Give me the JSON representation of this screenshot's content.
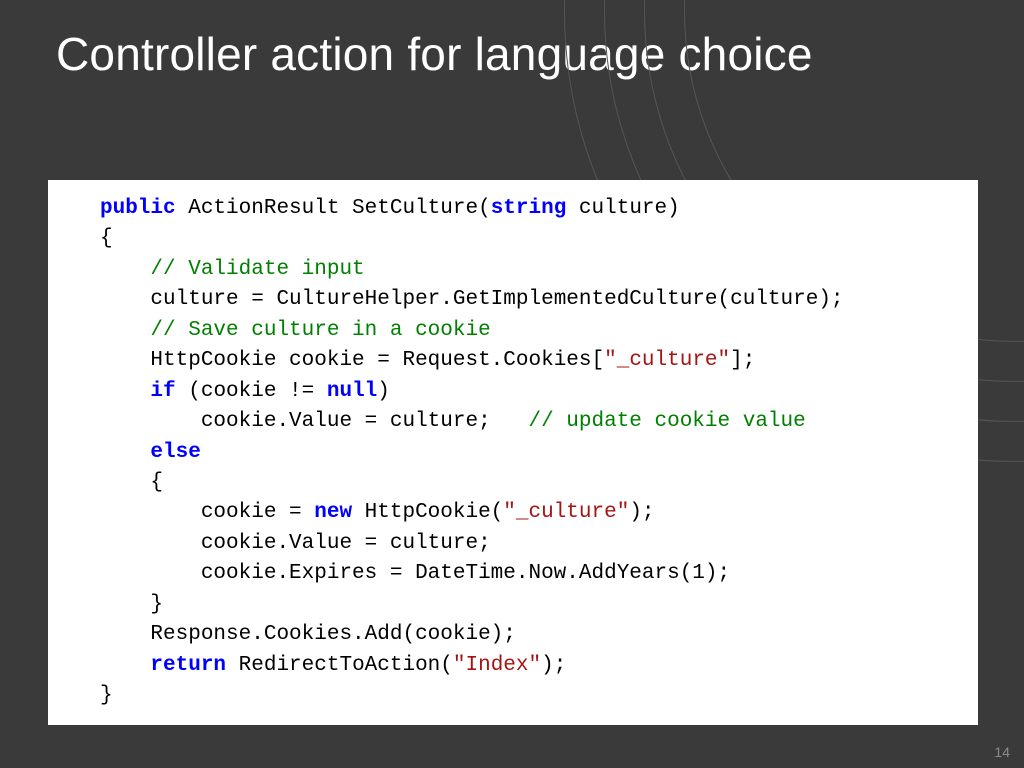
{
  "title": "Controller action for language choice",
  "page_number": "14",
  "code": {
    "l1": {
      "kw1": "public",
      "t1": " ActionResult SetCulture(",
      "kw2": "string",
      "t2": " culture)"
    },
    "l2": "{",
    "l3": {
      "indent": "    ",
      "cm": "// Validate input"
    },
    "l4": {
      "indent": "    ",
      "t": "culture = CultureHelper.GetImplementedCulture(culture);"
    },
    "l5": {
      "indent": "    ",
      "cm": "// Save culture in a cookie"
    },
    "l6": {
      "indent": "    ",
      "t1": "HttpCookie cookie = Request.Cookies[",
      "str": "\"_culture\"",
      "t2": "];"
    },
    "l7": {
      "indent": "    ",
      "kw": "if",
      "t1": " (cookie != ",
      "kw2": "null",
      "t2": ")"
    },
    "l8": {
      "indent": "        ",
      "t": "cookie.Value = culture;   ",
      "cm": "// update cookie value"
    },
    "l9": {
      "indent": "    ",
      "kw": "else"
    },
    "l10": {
      "indent": "    ",
      "t": "{"
    },
    "l11": {
      "indent": "        ",
      "t1": "cookie = ",
      "kw": "new",
      "t2": " HttpCookie(",
      "str": "\"_culture\"",
      "t3": ");"
    },
    "l12": {
      "indent": "        ",
      "t": "cookie.Value = culture;"
    },
    "l13": {
      "indent": "        ",
      "t": "cookie.Expires = DateTime.Now.AddYears(1);"
    },
    "l14": {
      "indent": "    ",
      "t": "}"
    },
    "l15": {
      "indent": "    ",
      "t": "Response.Cookies.Add(cookie);"
    },
    "l16": {
      "indent": "    ",
      "kw": "return",
      "t1": " RedirectToAction(",
      "str": "\"Index\"",
      "t2": ");"
    },
    "l17": "}"
  }
}
